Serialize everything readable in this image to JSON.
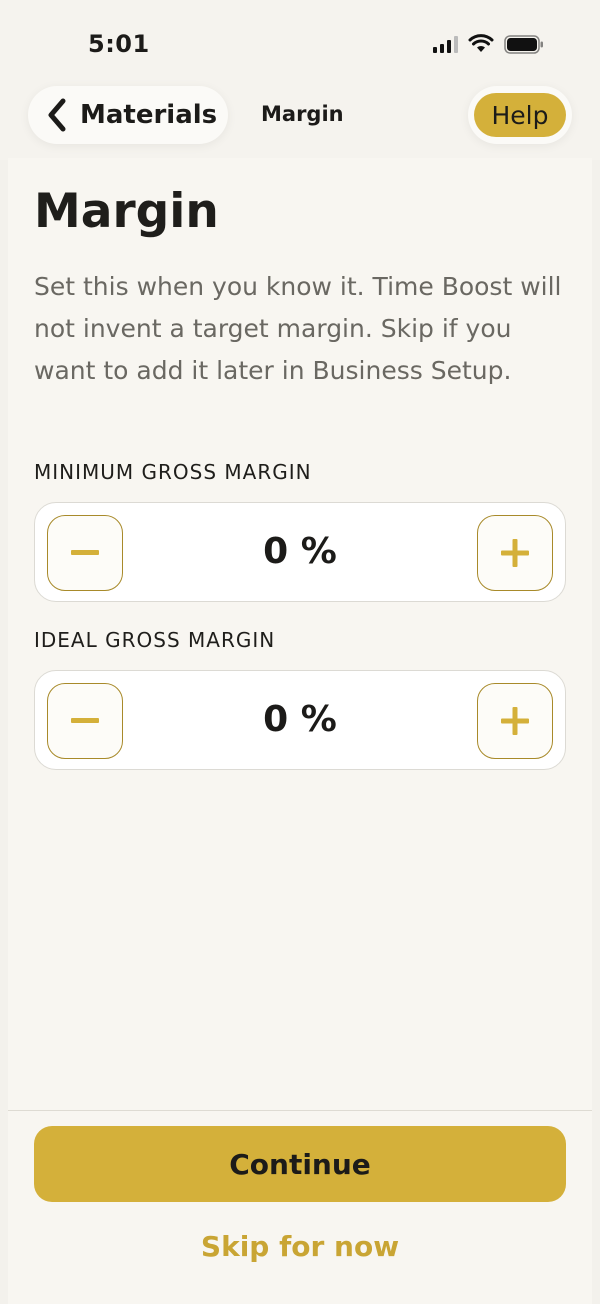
{
  "status_bar": {
    "time": "5:01"
  },
  "nav": {
    "back_label": "Materials",
    "title": "Margin",
    "help_label": "Help"
  },
  "page": {
    "title": "Margin",
    "description": "Set this when you know it. Time Boost will not invent a target margin. Skip if you want to add it later in Business Setup."
  },
  "fields": [
    {
      "label": "MINIMUM GROSS MARGIN",
      "value": "0 %"
    },
    {
      "label": "IDEAL GROSS MARGIN",
      "value": "0 %"
    }
  ],
  "actions": {
    "continue_label": "Continue",
    "skip_label": "Skip for now"
  },
  "colors": {
    "accent": "#d4b03a",
    "accent_text": "#c9a534",
    "background": "#f8f6f1"
  }
}
